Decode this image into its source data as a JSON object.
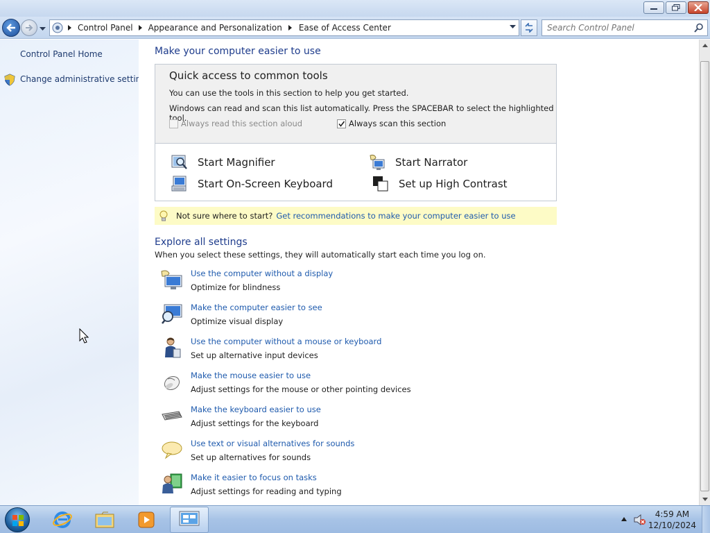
{
  "window": {
    "minimize_label": "Minimize",
    "maximize_label": "Restore",
    "close_label": "Close"
  },
  "address": {
    "crumbs": [
      "Control Panel",
      "Appearance and Personalization",
      "Ease of Access Center"
    ],
    "search_placeholder": "Search Control Panel"
  },
  "sidebar": {
    "items": [
      {
        "label": "Control Panel Home"
      },
      {
        "label": "Change administrative settings",
        "icon": "shield-icon"
      }
    ]
  },
  "main": {
    "title": "Make your computer easier to use",
    "quick": {
      "title": "Quick access to common tools",
      "line1": "You can use the tools in this section to help you get started.",
      "line2": "Windows can read and scan this list automatically.  Press the SPACEBAR to select the highlighted tool.",
      "read_aloud": {
        "label": "Always read this section aloud",
        "checked": false,
        "enabled": false
      },
      "scan": {
        "label": "Always scan this section",
        "checked": true,
        "enabled": true
      },
      "tools": [
        {
          "label": "Start Magnifier",
          "icon": "magnifier-icon"
        },
        {
          "label": "Start Narrator",
          "icon": "narrator-icon"
        },
        {
          "label": "Start On-Screen Keyboard",
          "icon": "on-screen-keyboard-icon"
        },
        {
          "label": "Set up High Contrast",
          "icon": "high-contrast-icon"
        }
      ]
    },
    "tip": {
      "prefix": "Not sure where to start?",
      "link": "Get recommendations to make your computer easier to use"
    },
    "explore": {
      "title": "Explore all settings",
      "subtitle": "When you select these settings, they will automatically start each time you log on.",
      "items": [
        {
          "link": "Use the computer without a display",
          "desc": "Optimize for blindness",
          "icon": "no-display-icon"
        },
        {
          "link": "Make the computer easier to see",
          "desc": "Optimize visual display",
          "icon": "easier-to-see-icon"
        },
        {
          "link": "Use the computer without a mouse or keyboard",
          "desc": "Set up alternative input devices",
          "icon": "alternative-input-icon"
        },
        {
          "link": "Make the mouse easier to use",
          "desc": "Adjust settings for the mouse or other pointing devices",
          "icon": "mouse-icon"
        },
        {
          "link": "Make the keyboard easier to use",
          "desc": "Adjust settings for the keyboard",
          "icon": "keyboard-icon"
        },
        {
          "link": "Use text or visual alternatives for sounds",
          "desc": "Set up alternatives for sounds",
          "icon": "speech-bubble-icon"
        },
        {
          "link": "Make it easier to focus on tasks",
          "desc": "Adjust settings for reading and typing",
          "icon": "focus-tasks-icon"
        }
      ]
    }
  },
  "taskbar": {
    "apps": [
      "internet-explorer-icon",
      "windows-explorer-icon",
      "media-player-icon",
      "control-panel-icon"
    ],
    "time": "4:59 AM",
    "date": "12/10/2024"
  },
  "colors": {
    "link": "#1e5aad",
    "heading": "#1e3c8c",
    "tip_background": "#fdfbc6"
  }
}
